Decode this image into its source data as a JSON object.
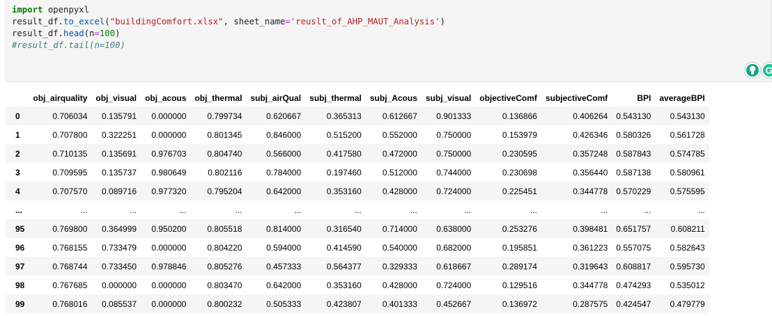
{
  "code_cell": {
    "lines": {
      "l1_kw": "import",
      "l1_rest": " openpyxl",
      "l2_a": "result_df.",
      "l2_fn": "to_excel",
      "l2_b": "(",
      "l2_str1": "\"buildingComfort.xlsx\"",
      "l2_c": ", sheet_name",
      "l2_eq": "=",
      "l2_str2": "'reuslt_of_AHP_MAUT_Analysis'",
      "l2_d": ")",
      "l3_a": "result_df.",
      "l3_fn": "head",
      "l3_b": "(n",
      "l3_eq": "=",
      "l3_num": "100",
      "l3_c": ")",
      "l4_comment": "#result_df.tail(n=100)"
    },
    "icons": [
      "lightbulb-icon",
      "grammarly-icon"
    ],
    "grammarly_letter": "G"
  },
  "dataframe": {
    "columns": [
      "",
      "obj_airquality",
      "obj_visual",
      "obj_acous",
      "obj_thermal",
      "subj_airQual",
      "subj_thermal",
      "subj_Acous",
      "subj_visual",
      "objectiveComf",
      "subjectiveComf",
      "BPI",
      "averageBPI"
    ],
    "rows": [
      [
        "0",
        "0.706034",
        "0.135791",
        "0.000000",
        "0.799734",
        "0.620667",
        "0.365313",
        "0.612667",
        "0.901333",
        "0.136866",
        "0.406264",
        "0.543130",
        "0.543130"
      ],
      [
        "1",
        "0.707800",
        "0.322251",
        "0.000000",
        "0.801345",
        "0.846000",
        "0.515200",
        "0.552000",
        "0.750000",
        "0.153979",
        "0.426346",
        "0.580326",
        "0.561728"
      ],
      [
        "2",
        "0.710135",
        "0.135691",
        "0.976703",
        "0.804740",
        "0.566000",
        "0.417580",
        "0.472000",
        "0.750000",
        "0.230595",
        "0.357248",
        "0.587843",
        "0.574785"
      ],
      [
        "3",
        "0.709595",
        "0.135737",
        "0.980649",
        "0.802116",
        "0.784000",
        "0.197460",
        "0.512000",
        "0.744000",
        "0.230698",
        "0.356440",
        "0.587138",
        "0.580961"
      ],
      [
        "4",
        "0.707570",
        "0.089716",
        "0.977320",
        "0.795204",
        "0.642000",
        "0.353160",
        "0.428000",
        "0.724000",
        "0.225451",
        "0.344778",
        "0.570229",
        "0.575595"
      ],
      [
        "...",
        "...",
        "...",
        "...",
        "...",
        "...",
        "...",
        "...",
        "...",
        "...",
        "...",
        "...",
        "..."
      ],
      [
        "95",
        "0.769800",
        "0.364999",
        "0.950200",
        "0.805518",
        "0.814000",
        "0.316540",
        "0.714000",
        "0.638000",
        "0.253276",
        "0.398481",
        "0.651757",
        "0.608211"
      ],
      [
        "96",
        "0.768155",
        "0.733479",
        "0.000000",
        "0.804220",
        "0.594000",
        "0.414590",
        "0.540000",
        "0.682000",
        "0.195851",
        "0.361223",
        "0.557075",
        "0.582643"
      ],
      [
        "97",
        "0.768744",
        "0.733450",
        "0.978846",
        "0.805276",
        "0.457333",
        "0.564377",
        "0.329333",
        "0.618667",
        "0.289174",
        "0.319643",
        "0.608817",
        "0.595730"
      ],
      [
        "98",
        "0.767685",
        "0.000000",
        "0.000000",
        "0.803470",
        "0.642000",
        "0.353160",
        "0.428000",
        "0.724000",
        "0.129516",
        "0.344778",
        "0.474293",
        "0.535012"
      ],
      [
        "99",
        "0.768016",
        "0.085537",
        "0.000000",
        "0.800232",
        "0.505333",
        "0.423807",
        "0.401333",
        "0.452667",
        "0.136972",
        "0.287575",
        "0.424547",
        "0.479779"
      ]
    ]
  },
  "colors": {
    "code_bg": "#f5f5f5",
    "keyword": "#008000",
    "string": "#ba2121",
    "function": "#0055aa",
    "comment": "#408080",
    "grammarly": "#15c39a"
  }
}
